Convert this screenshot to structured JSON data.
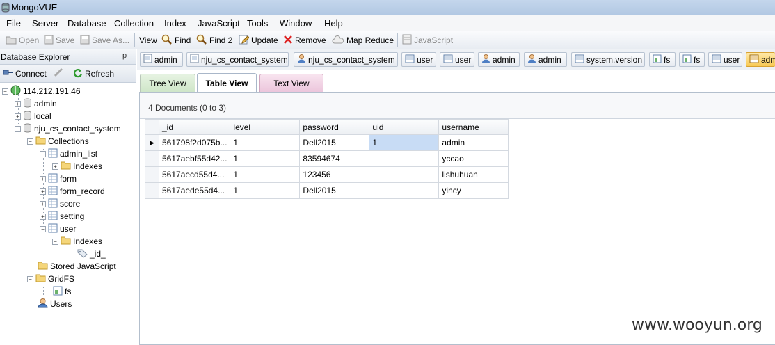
{
  "window": {
    "title": "MongoVUE"
  },
  "menu": [
    {
      "label": "File"
    },
    {
      "label": "Server"
    },
    {
      "label": "Database"
    },
    {
      "label": "Collection"
    },
    {
      "label": "Index"
    },
    {
      "label": "JavaScript"
    },
    {
      "label": "Tools"
    },
    {
      "label": "Window"
    },
    {
      "label": "Help"
    }
  ],
  "toolbar": {
    "open": "Open",
    "save": "Save",
    "save_as": "Save As...",
    "view": "View",
    "find": "Find",
    "find2": "Find 2",
    "update": "Update",
    "remove": "Remove",
    "map_reduce": "Map Reduce",
    "javascript": "JavaScript"
  },
  "explorer": {
    "title": "Database Explorer",
    "pin": "ᵽ",
    "connect": "Connect",
    "refresh": "Refresh",
    "tree": {
      "server": "114.212.191.46",
      "admin": "admin",
      "local": "local",
      "db": "nju_cs_contact_system",
      "collections": "Collections",
      "admin_list": "admin_list",
      "indexes1": "Indexes",
      "form": "form",
      "form_record": "form_record",
      "score": "score",
      "setting": "setting",
      "user": "user",
      "indexes2": "Indexes",
      "id_index": "_id_",
      "stored_js": "Stored JavaScript",
      "gridfs": "GridFS",
      "fs": "fs",
      "users": "Users"
    }
  },
  "doc_tabs": [
    {
      "label": "admin"
    },
    {
      "label": "nju_cs_contact_system"
    },
    {
      "label": "nju_cs_contact_system"
    },
    {
      "label": "user"
    },
    {
      "label": "user"
    },
    {
      "label": "admin"
    },
    {
      "label": "admin"
    },
    {
      "label": "system.version"
    },
    {
      "label": "fs"
    },
    {
      "label": "fs"
    },
    {
      "label": "user"
    },
    {
      "label": "adm"
    }
  ],
  "view_tabs": {
    "tree": "Tree View",
    "table": "Table View",
    "text": "Text View"
  },
  "documents": {
    "count_text": "4 Documents (0 to 3)",
    "columns": [
      "_id",
      "level",
      "password",
      "uid",
      "username"
    ],
    "rows": [
      [
        "561798f2d075b...",
        "1",
        "Dell2015",
        "1",
        "admin"
      ],
      [
        "5617aebf55d42...",
        "1",
        "83594674",
        "",
        "yccao"
      ],
      [
        "5617aecd55d4...",
        "1",
        "123456",
        "",
        "lishuhuan"
      ],
      [
        "5617aede55d4...",
        "1",
        "Dell2015",
        "",
        "yincy"
      ]
    ],
    "row_marker": "▶"
  },
  "watermark": "www.wooyun.org",
  "colors": {
    "accent": "#f8c955",
    "selection": "#c8dcf5",
    "tree_active": "#d6ecd2",
    "text_view": "#f4d6e7"
  }
}
